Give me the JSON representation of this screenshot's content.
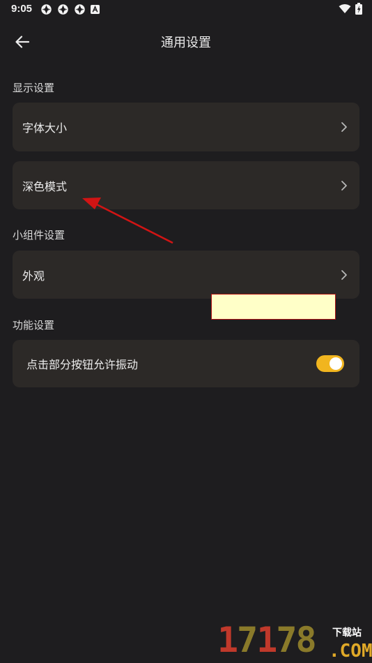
{
  "status_bar": {
    "time": "9:05"
  },
  "header": {
    "title": "通用设置"
  },
  "sections": {
    "display": {
      "label": "显示设置"
    },
    "widget": {
      "label": "小组件设置"
    },
    "function": {
      "label": "功能设置"
    }
  },
  "items": {
    "font_size": "字体大小",
    "dark_mode": "深色模式",
    "appearance": "外观",
    "vibration": "点击部分按钮允许振动"
  },
  "toggle": {
    "vibration_on": true
  },
  "watermark": {
    "digits": [
      "1",
      "7",
      "1",
      "7",
      "8"
    ],
    "site": "下载站",
    "domain": ".COM"
  },
  "colors": {
    "accent": "#f1b51f",
    "background": "#1e1d1f",
    "card": "#2c2927",
    "annotation": "#d11414"
  }
}
